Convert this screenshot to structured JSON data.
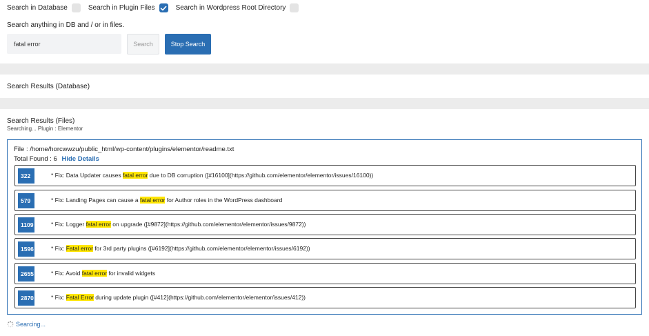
{
  "options": [
    {
      "label": "Search in Database",
      "checked": false
    },
    {
      "label": "Search in Plugin Files",
      "checked": true
    },
    {
      "label": "Search in Wordpress Root Directory",
      "checked": false
    }
  ],
  "hint": "Search anything in DB and / or in files.",
  "search": {
    "value": "fatal error"
  },
  "buttons": {
    "search": "Search",
    "stop": "Stop Search"
  },
  "db_results": {
    "title": "Search Results (Database)"
  },
  "file_results": {
    "title": "Search Results (Files)",
    "subtitle": "Searching... Plugin : Elementor",
    "file_path": "File : /home/horcwwzu/public_html/wp-content/plugins/elementor/readme.txt",
    "total_found_label": "Total Found : 6",
    "hide_details": "Hide Details",
    "rows": [
      {
        "line": "322",
        "before": "* Fix: Data Updater causes ",
        "match": "fatal error",
        "after": " due to DB corruption ([#16100](https://github.com/elementor/elementor/issues/16100))"
      },
      {
        "line": "579",
        "before": "* Fix: Landing Pages can cause a ",
        "match": "fatal error",
        "after": " for Author roles in the WordPress dashboard"
      },
      {
        "line": "1109",
        "before": "* Fix: Logger ",
        "match": "fatal error",
        "after": " on upgrade ([#9872](https://github.com/elementor/elementor/issues/9872))"
      },
      {
        "line": "1596",
        "before": "* Fix: ",
        "match": "Fatal error",
        "after": " for 3rd party plugins ([#6192](https://github.com/elementor/elementor/issues/6192))"
      },
      {
        "line": "2655",
        "before": "* Fix: Avoid ",
        "match": "fatal error",
        "after": " for invalid widgets"
      },
      {
        "line": "2870",
        "before": "* Fix: ",
        "match": "Fatal Error",
        "after": " during update plugin ([#412](https://github.com/elementor/elementor/issues/412))"
      }
    ]
  },
  "status": {
    "text": "Searcing..."
  },
  "colors": {
    "accent": "#2a6eb3",
    "highlight": "#ffe600"
  }
}
